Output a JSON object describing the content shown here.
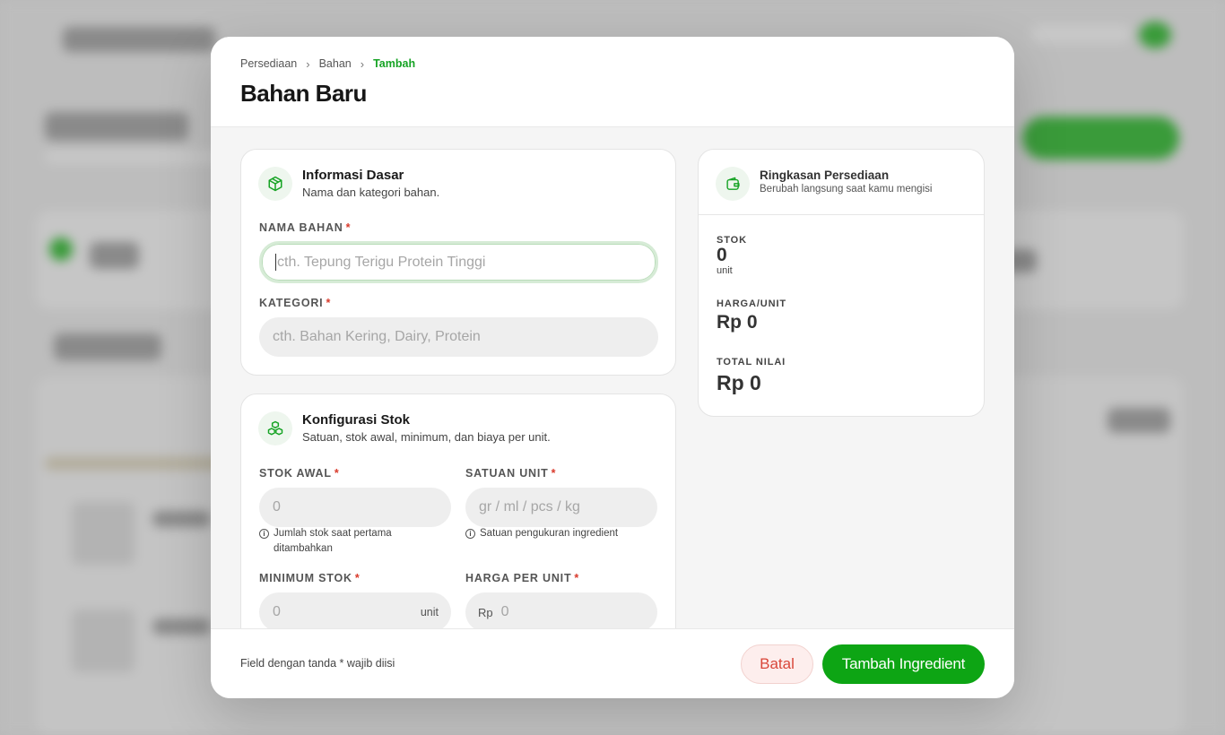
{
  "breadcrumb": {
    "items": [
      "Persediaan",
      "Bahan"
    ],
    "current": "Tambah",
    "separator": "›"
  },
  "page_title": "Bahan Baru",
  "info_section": {
    "icon": "box-icon",
    "title": "Informasi Dasar",
    "subtitle": "Nama dan kategori bahan.",
    "name_field": {
      "label": "NAMA BAHAN",
      "placeholder": "cth. Tepung Terigu Protein Tinggi",
      "value": ""
    },
    "category_field": {
      "label": "KATEGORI",
      "placeholder": "cth. Bahan Kering, Dairy, Protein",
      "value": ""
    }
  },
  "stock_section": {
    "icon": "boxes-icon",
    "title": "Konfigurasi Stok",
    "subtitle": "Satuan, stok awal, minimum, dan biaya per unit.",
    "initial_stock": {
      "label": "STOK AWAL",
      "placeholder": "0",
      "help": "Jumlah stok saat pertama ditambahkan"
    },
    "unit": {
      "label": "SATUAN UNIT",
      "placeholder": "gr / ml / pcs / kg",
      "help": "Satuan pengukuran ingredient"
    },
    "min_stock": {
      "label": "MINIMUM STOK",
      "placeholder": "0",
      "suffix": "unit"
    },
    "price_per_unit": {
      "label": "HARGA PER UNIT",
      "placeholder": "0",
      "prefix": "Rp"
    }
  },
  "required_mark": "*",
  "summary": {
    "icon": "wallet-icon",
    "title": "Ringkasan Persediaan",
    "subtitle": "Berubah langsung saat kamu mengisi",
    "stock_label": "STOK",
    "stock_value": "0",
    "stock_unit": "unit",
    "price_label": "HARGA/UNIT",
    "price_value": "Rp 0",
    "total_label": "TOTAL NILAI",
    "total_value": "Rp 0"
  },
  "footer": {
    "note": "Field dengan tanda * wajib diisi",
    "cancel_label": "Batal",
    "submit_label": "Tambah Ingredient"
  },
  "colors": {
    "accent": "#0da514",
    "danger": "#d9473a",
    "required": "#d93a2b"
  }
}
